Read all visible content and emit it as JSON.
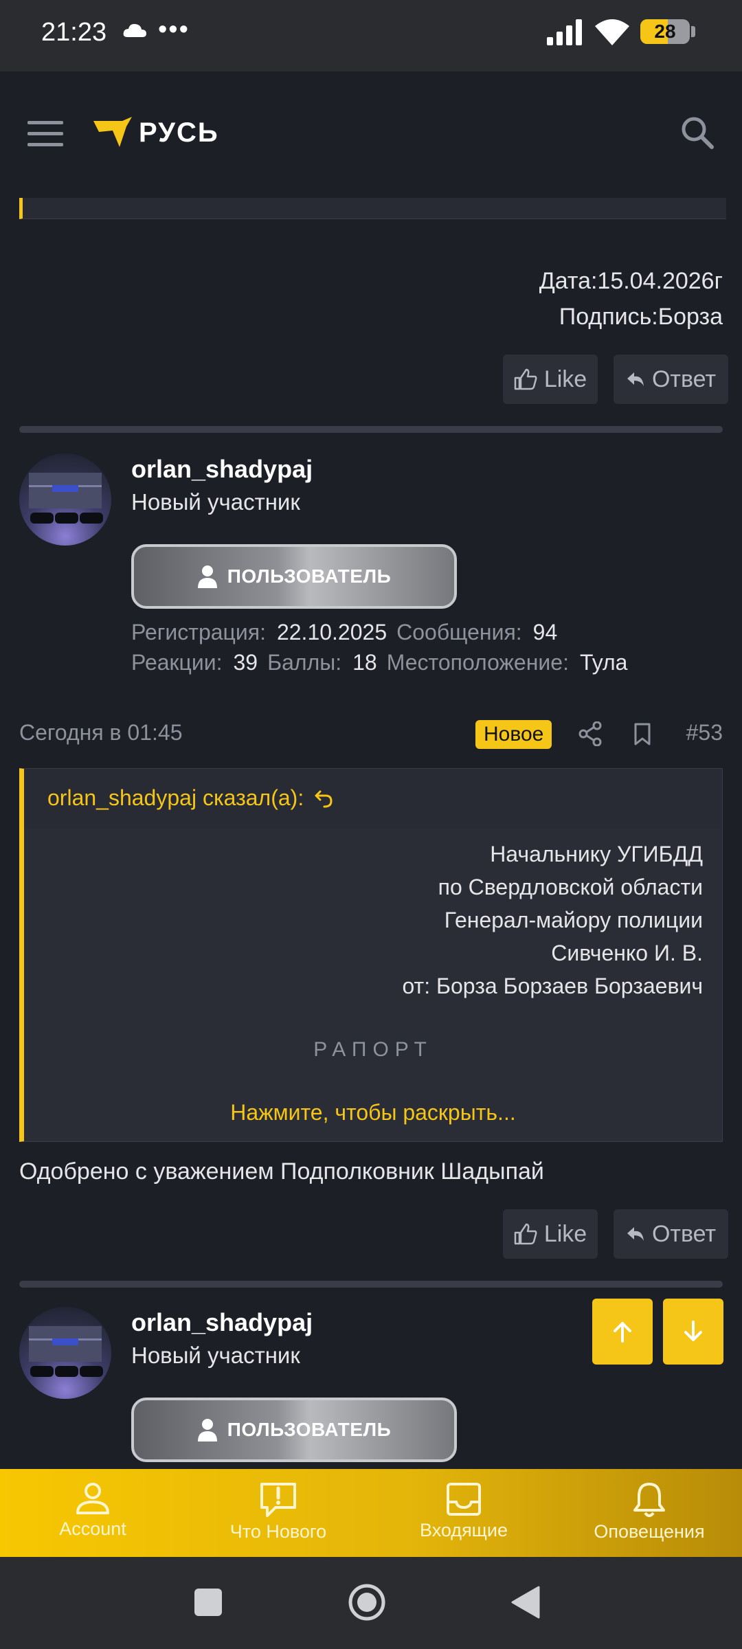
{
  "status_bar": {
    "time": "21:23",
    "dots": "•••",
    "battery": "28"
  },
  "header": {
    "logo_text": "РУСЬ"
  },
  "prev_post": {
    "date_line": "Дата:15.04.2026г",
    "signature_line": "Подпись:Борза",
    "like_label": "Like",
    "reply_label": "Ответ"
  },
  "post": {
    "username": "orlan_shadypaj",
    "user_title": "Новый участник",
    "role_badge": "ПОЛЬЗОВАТЕЛЬ",
    "stats": {
      "registration_label": "Регистрация:",
      "registration_value": "22.10.2025",
      "messages_label": "Сообщения:",
      "messages_value": "94",
      "reactions_label": "Реакции:",
      "reactions_value": "39",
      "points_label": "Баллы:",
      "points_value": "18",
      "location_label": "Местоположение:",
      "location_value": "Тула"
    },
    "date": "Сегодня в 01:45",
    "new_badge": "Новое",
    "number": "#53",
    "quote": {
      "author": "orlan_shadypaj сказал(а):",
      "lines": [
        "Начальнику УГИБДД",
        "по Свердловской области",
        "Генерал-майору полиции",
        "Сивченко И. В.",
        "от: Борза Борзаев Борзаевич"
      ],
      "title": "РАПОРТ",
      "expand_label": "Нажмите, чтобы раскрыть..."
    },
    "body_text": "Одобрено с уважением Подполковник Шадыпай",
    "like_label": "Like",
    "reply_label": "Ответ"
  },
  "next_post": {
    "username": "orlan_shadypaj",
    "user_title": "Новый участник",
    "role_badge": "ПОЛЬЗОВАТЕЛЬ"
  },
  "bottom_nav": [
    {
      "label": "Account",
      "icon": "account-icon"
    },
    {
      "label": "Что Нового",
      "icon": "whats-new-icon"
    },
    {
      "label": "Входящие",
      "icon": "inbox-icon"
    },
    {
      "label": "Оповещения",
      "icon": "bell-icon"
    }
  ],
  "colors": {
    "accent": "#f5c518",
    "background": "#1d1f27",
    "panel": "#282b34"
  }
}
